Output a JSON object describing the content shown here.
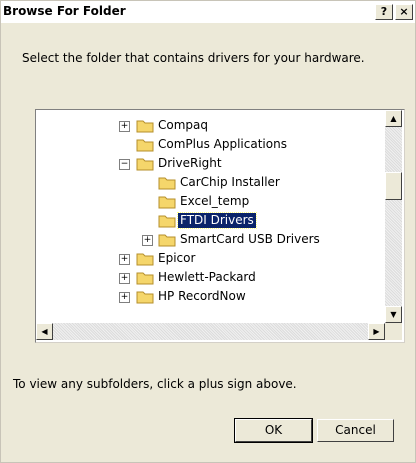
{
  "window": {
    "title": "Browse For Folder",
    "help_label": "?",
    "close_label": "×"
  },
  "prompt": "Select the folder that contains drivers for your hardware.",
  "tree": {
    "items": [
      {
        "label": "Compaq",
        "toggle": "+",
        "selected": false
      },
      {
        "label": "ComPlus Applications",
        "toggle": "",
        "selected": false
      },
      {
        "label": "DriveRight",
        "toggle": "−",
        "selected": false
      },
      {
        "label": "CarChip Installer",
        "toggle": "",
        "selected": false
      },
      {
        "label": "Excel_temp",
        "toggle": "",
        "selected": false
      },
      {
        "label": "FTDI Drivers",
        "toggle": "",
        "selected": true
      },
      {
        "label": "SmartCard USB Drivers",
        "toggle": "+",
        "selected": false
      },
      {
        "label": "Epicor",
        "toggle": "+",
        "selected": false
      },
      {
        "label": "Hewlett-Packard",
        "toggle": "+",
        "selected": false
      },
      {
        "label": "HP RecordNow",
        "toggle": "+",
        "selected": false
      }
    ]
  },
  "hint": "To view any subfolders, click a plus sign above.",
  "buttons": {
    "ok": "OK",
    "cancel": "Cancel"
  },
  "colors": {
    "dialog_bg": "#ece9d8",
    "selection": "#0a246a",
    "folder": "#f5d66b"
  }
}
